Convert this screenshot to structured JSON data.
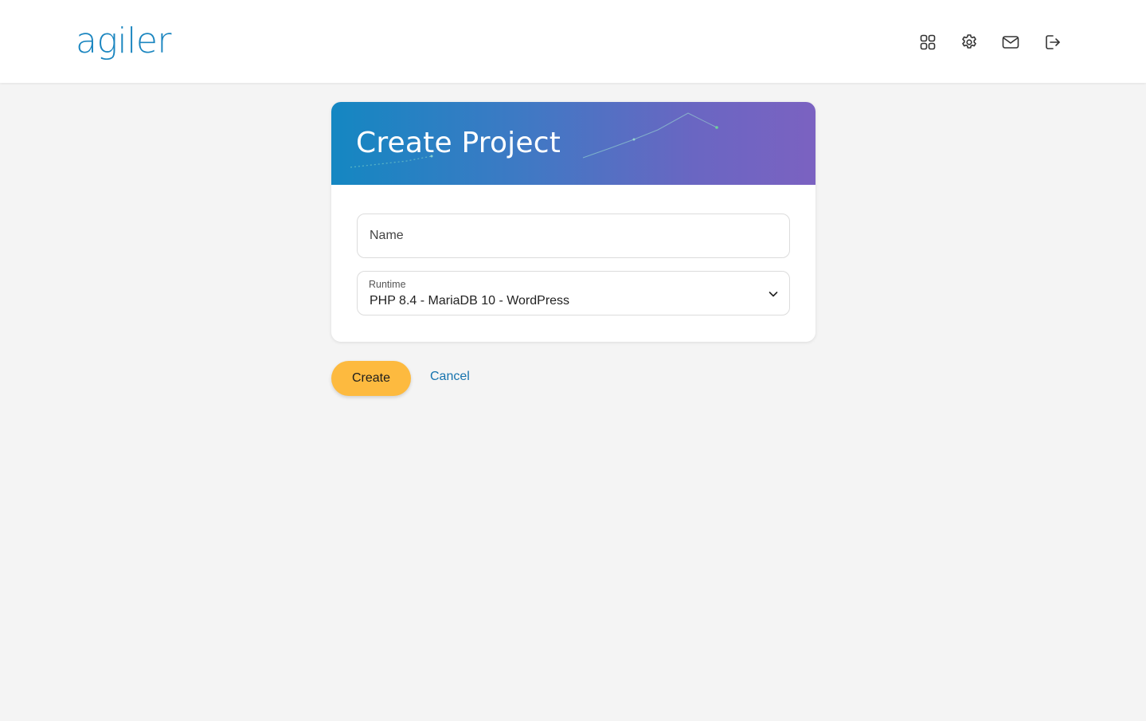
{
  "header": {
    "logo_text": "agiler",
    "nav": [
      {
        "icon": "grid-icon"
      },
      {
        "icon": "gear-icon"
      },
      {
        "icon": "mail-icon"
      },
      {
        "icon": "logout-icon"
      }
    ]
  },
  "form": {
    "title": "Create Project",
    "name_field": {
      "placeholder": "Name",
      "value": ""
    },
    "runtime_field": {
      "label": "Runtime",
      "value": "PHP 8.4 - MariaDB 10 - WordPress"
    }
  },
  "actions": {
    "create_label": "Create",
    "cancel_label": "Cancel"
  },
  "colors": {
    "brand": "#1b86c0",
    "header_gradient_start": "#1487c2",
    "header_gradient_end": "#7b62c1",
    "primary_button": "#fdba3f",
    "link": "#1673ae",
    "background": "#f4f4f4"
  }
}
